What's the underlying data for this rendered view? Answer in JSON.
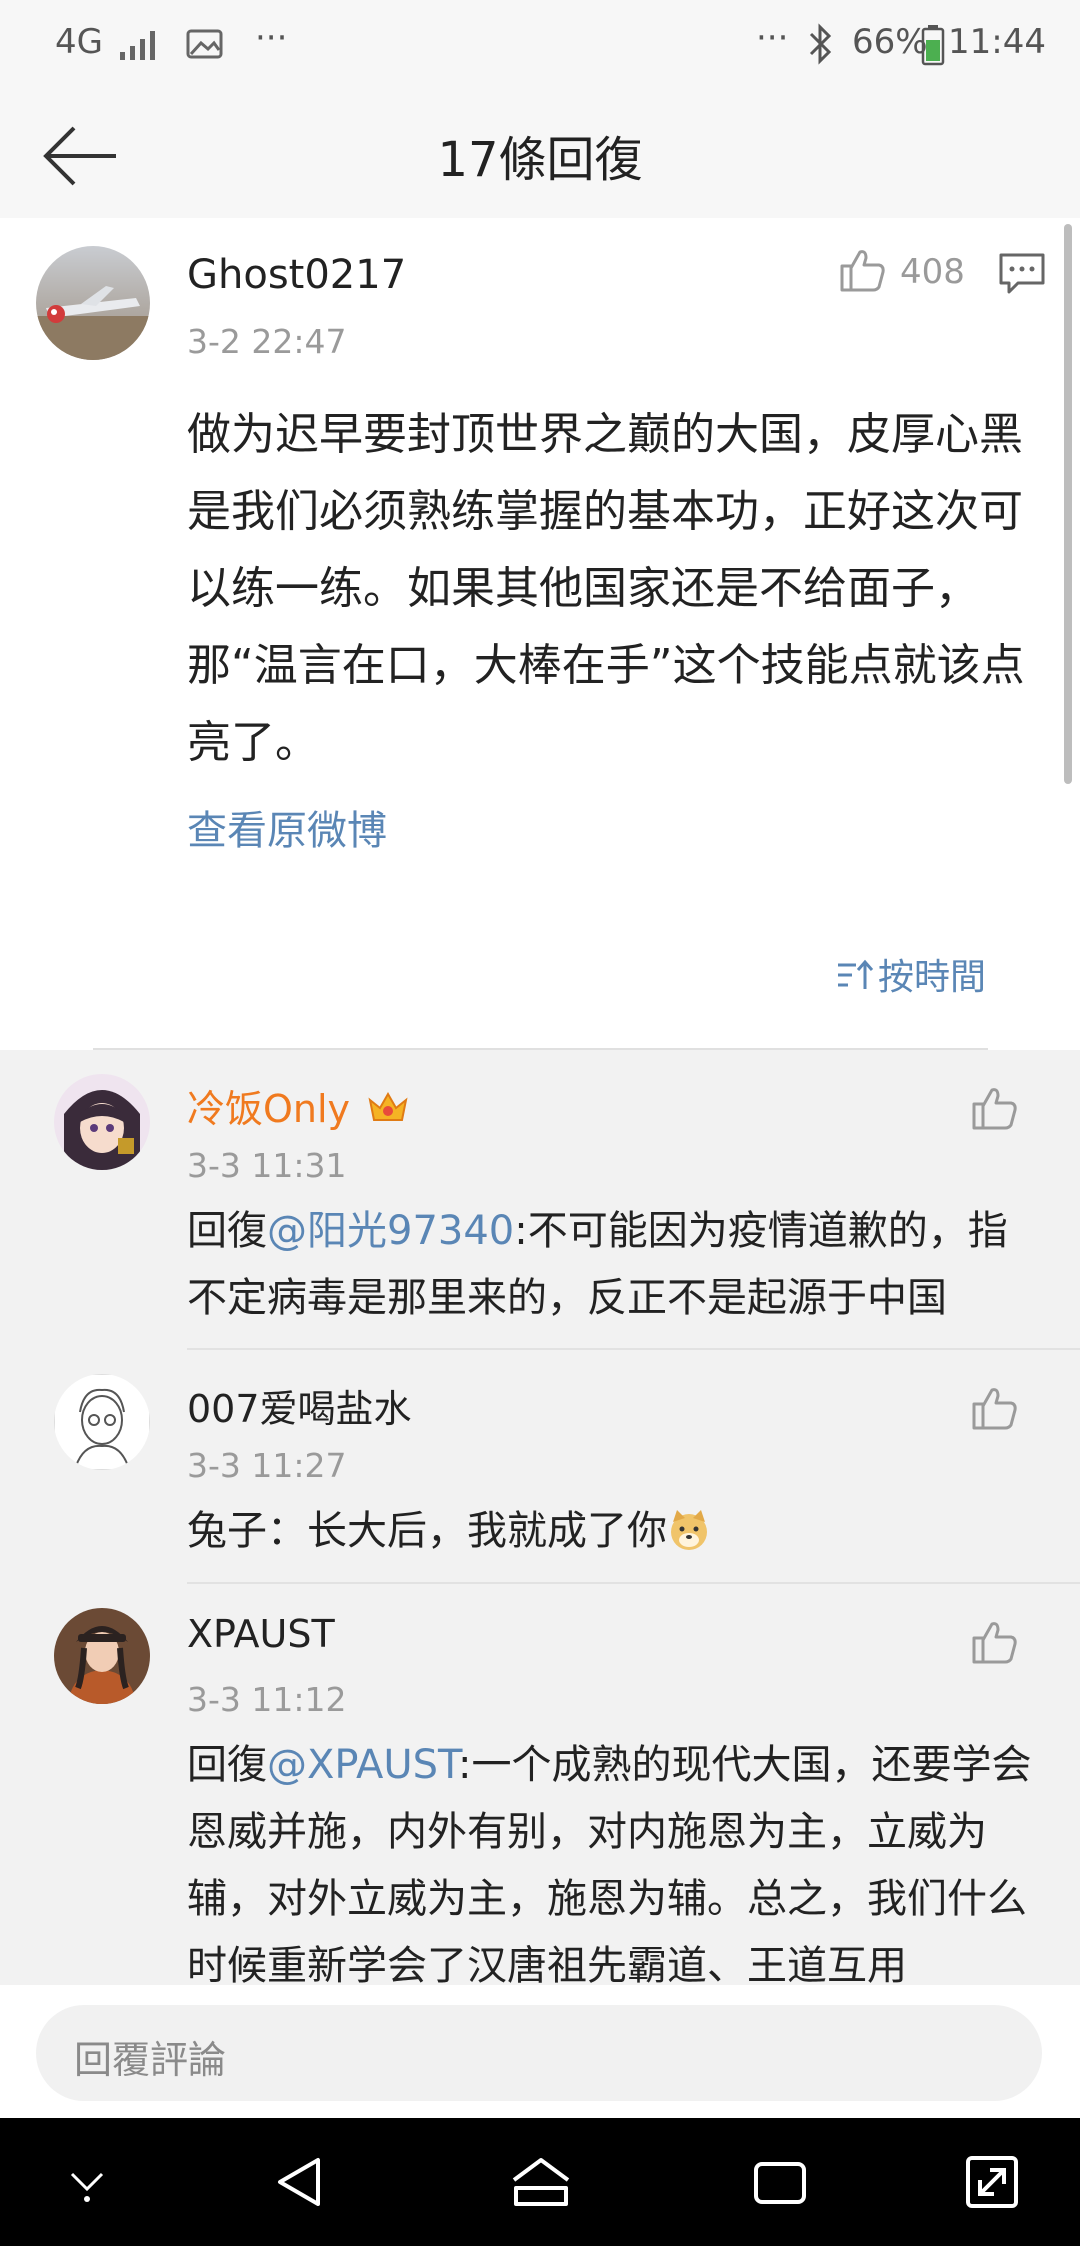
{
  "status_bar": {
    "network": "4G",
    "more": "···",
    "more_right": "···",
    "battery": "66%",
    "time": "11:44"
  },
  "header": {
    "title": "17條回復"
  },
  "main_comment": {
    "user": "Ghost0217",
    "time": "3-2 22:47",
    "likes": "408",
    "text": "做为迟早要封顶世界之巅的大国，皮厚心黑是我们必须熟练掌握的基本功，正好这次可以练一练。如果其他国家还是不给面子，那“温言在口，大棒在手”这个技能点就该点亮了。",
    "view_original": "查看原微博",
    "sort_label": "按時間"
  },
  "replies": [
    {
      "user": "冷饭Only",
      "time": "3-3 11:31",
      "prefix": "回復",
      "mention": "@阳光97340",
      "text": ":不可能因为疫情道歉的，指不定病毒是那里来的，反正不是起源于中国"
    },
    {
      "user": "007爱喝盐水",
      "time": "3-3 11:27",
      "prefix": "",
      "mention": "",
      "text": "兔子：长大后，我就成了你"
    },
    {
      "user": "XPAUST",
      "time": "3-3 11:12",
      "prefix": "回復",
      "mention": "@XPAUST",
      "text": ":一个成熟的现代大国，还要学会恩威并施，内外有别，对内施恩为主，立威为辅，对外立威为主，施恩为辅。总之，我们什么时候重新学会了汉唐祖先霸道、王道互用"
    }
  ],
  "input": {
    "placeholder": "回覆評論"
  },
  "colors": {
    "link": "#5a86b5",
    "vip_name": "#f07a1f",
    "background_replies": "#f2f2f2"
  }
}
